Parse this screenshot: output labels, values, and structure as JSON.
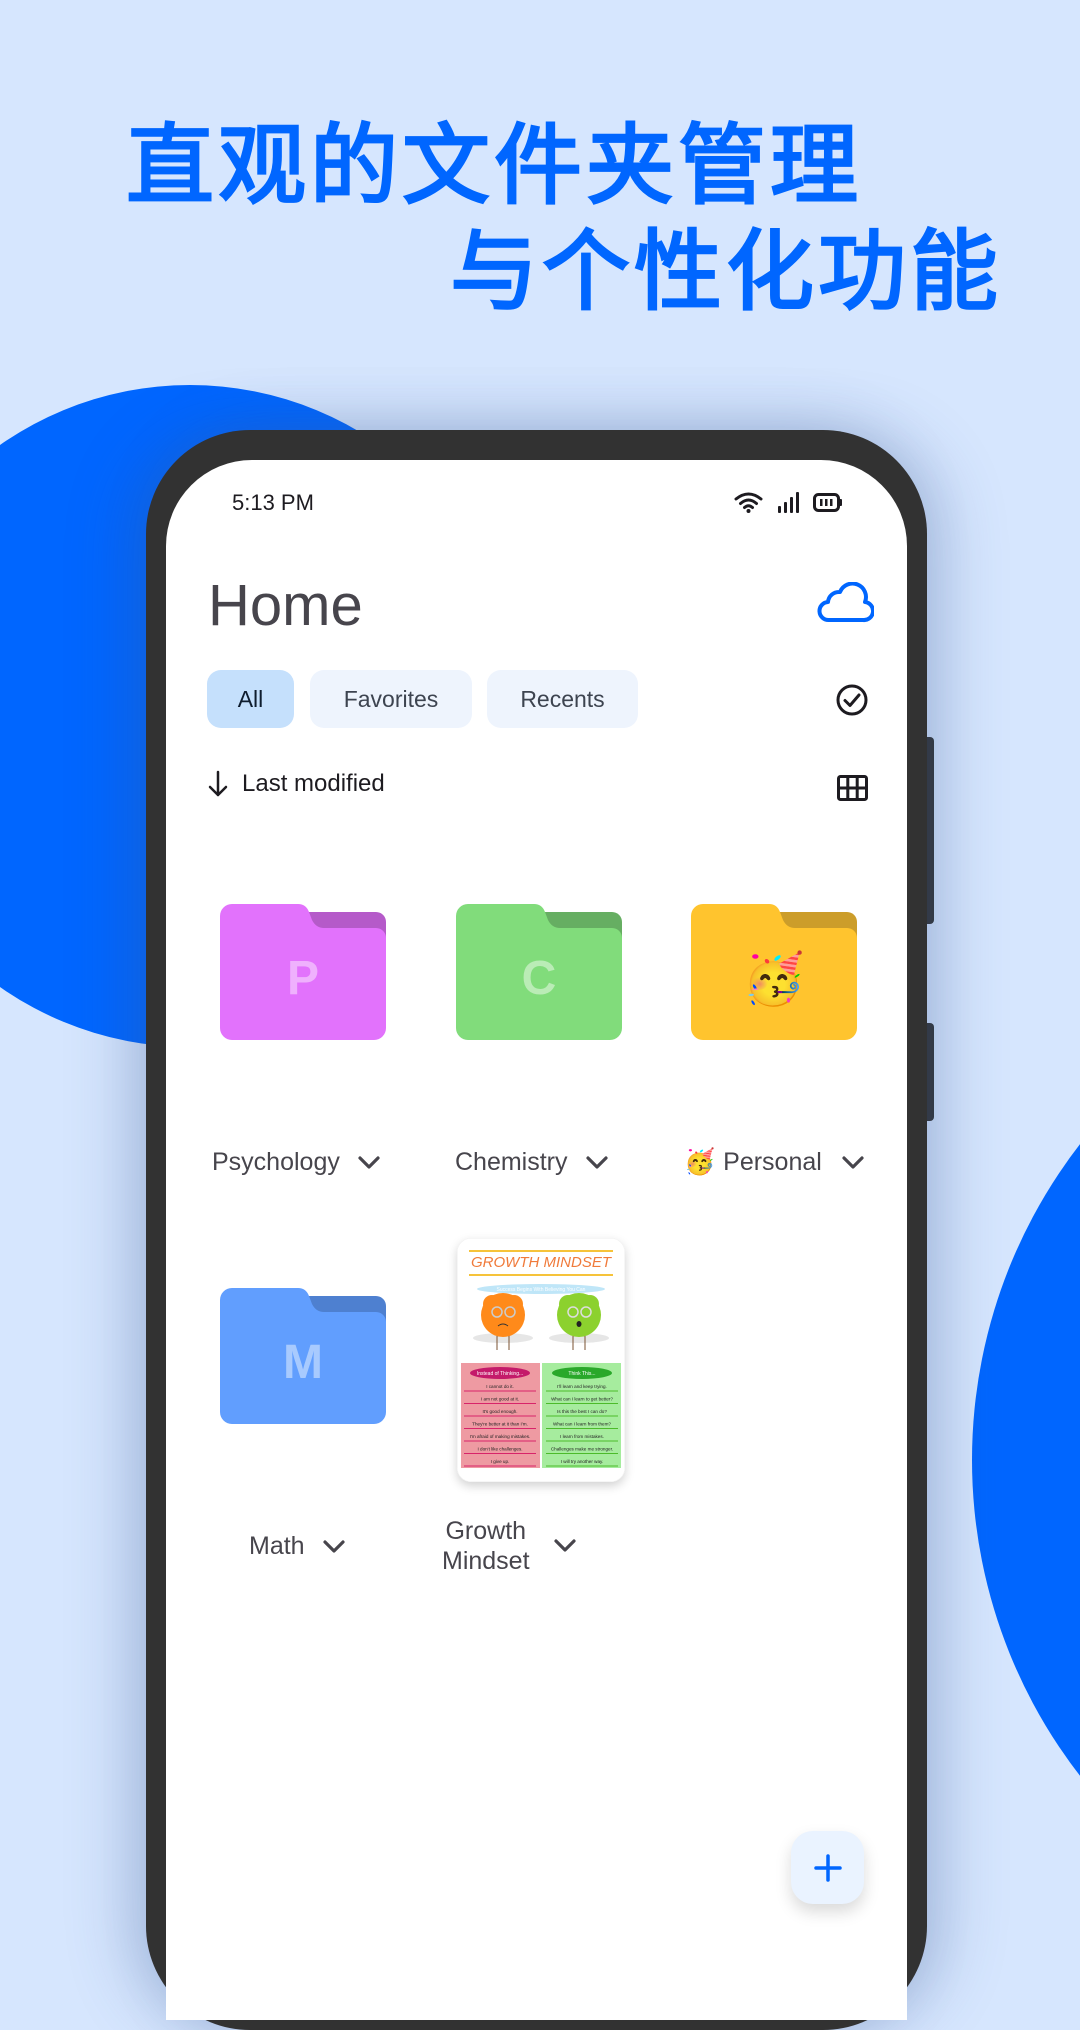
{
  "headline": {
    "line1": "直观的文件夹管理",
    "line2": "与个性化功能"
  },
  "status_bar": {
    "time": "5:13 PM",
    "icons": [
      "wifi-icon",
      "signal-icon",
      "battery-icon"
    ]
  },
  "header": {
    "title": "Home",
    "cloud_icon": "cloud-icon"
  },
  "filters": {
    "chips": [
      {
        "label": "All",
        "selected": true
      },
      {
        "label": "Favorites",
        "selected": false
      },
      {
        "label": "Recents",
        "selected": false
      }
    ],
    "select_icon": "check-circle-icon"
  },
  "sort": {
    "label": "Last modified",
    "direction_icon": "arrow-down-icon",
    "view_icon": "grid-view-icon"
  },
  "items": [
    {
      "name": "Psychology",
      "type": "folder",
      "letter": "P",
      "color": "#e272fc",
      "tab_color": "#b55ac9"
    },
    {
      "name": "Chemistry",
      "type": "folder",
      "letter": "C",
      "color": "#81dc7b",
      "tab_color": "#66ae62"
    },
    {
      "name": "Personal",
      "type": "folder",
      "emoji": "🥳",
      "color": "#ffc42e",
      "tab_color": "#cc9d2a"
    },
    {
      "name": "Math",
      "type": "folder",
      "letter": "M",
      "color": "#619efe",
      "tab_color": "#4e80d0"
    },
    {
      "name": "Growth Mindset",
      "line1": "Growth",
      "line2": "Mindset",
      "type": "document"
    }
  ],
  "thumbnail": {
    "title": "GROWTH MINDSET",
    "subtitle": "Success Begins With Believing You Can",
    "left_header": "Instead of Thinking...",
    "right_header": "Think This...",
    "left_lines": [
      "I cannot do it.",
      "I am not good at it.",
      "It's good enough.",
      "They're better at it than I'm.",
      "I'm afraid of making mistakes.",
      "I don't like challenges.",
      "I give up."
    ],
    "right_lines": [
      "I'll learn and keep trying.",
      "What can I learn to get better?",
      "Is this the best I can do?",
      "What can I learn from them?",
      "I learn from mistakes.",
      "Challenges make me stronger.",
      "I will try another way."
    ]
  },
  "fab": {
    "icon": "plus-icon",
    "label": "+"
  },
  "colors": {
    "accent": "#0066ff",
    "background": "#d6e6fe",
    "chip_selected": "#c5e0fc",
    "chip": "#eef4fd"
  }
}
